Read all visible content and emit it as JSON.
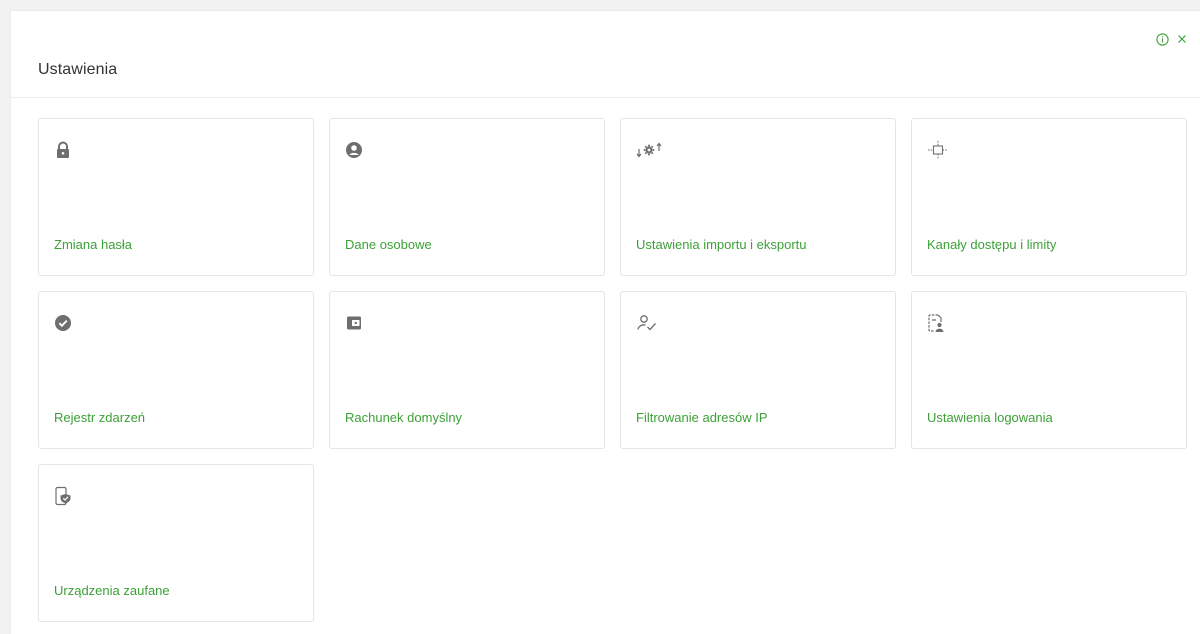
{
  "header": {
    "title": "Ustawienia",
    "info_icon": "info-icon",
    "close_icon": "close-icon"
  },
  "colors": {
    "accent": "#3da038",
    "icon": "#6e6e6e",
    "title": "#333333"
  },
  "tiles": [
    {
      "label": "Zmiana hasła",
      "icon": "lock-icon"
    },
    {
      "label": "Dane osobowe",
      "icon": "user-circle-icon"
    },
    {
      "label": "Ustawienia importu i eksportu",
      "icon": "import-export-gear-icon"
    },
    {
      "label": "Kanały dostępu i limity",
      "icon": "access-channels-icon"
    },
    {
      "label": "Rejestr zdarzeń",
      "icon": "check-circle-icon"
    },
    {
      "label": "Rachunek domyślny",
      "icon": "wallet-icon"
    },
    {
      "label": "Filtrowanie adresów IP",
      "icon": "user-check-icon"
    },
    {
      "label": "Ustawienia logowania",
      "icon": "login-settings-icon"
    },
    {
      "label": "Urządzenia zaufane",
      "icon": "trusted-device-icon"
    }
  ]
}
